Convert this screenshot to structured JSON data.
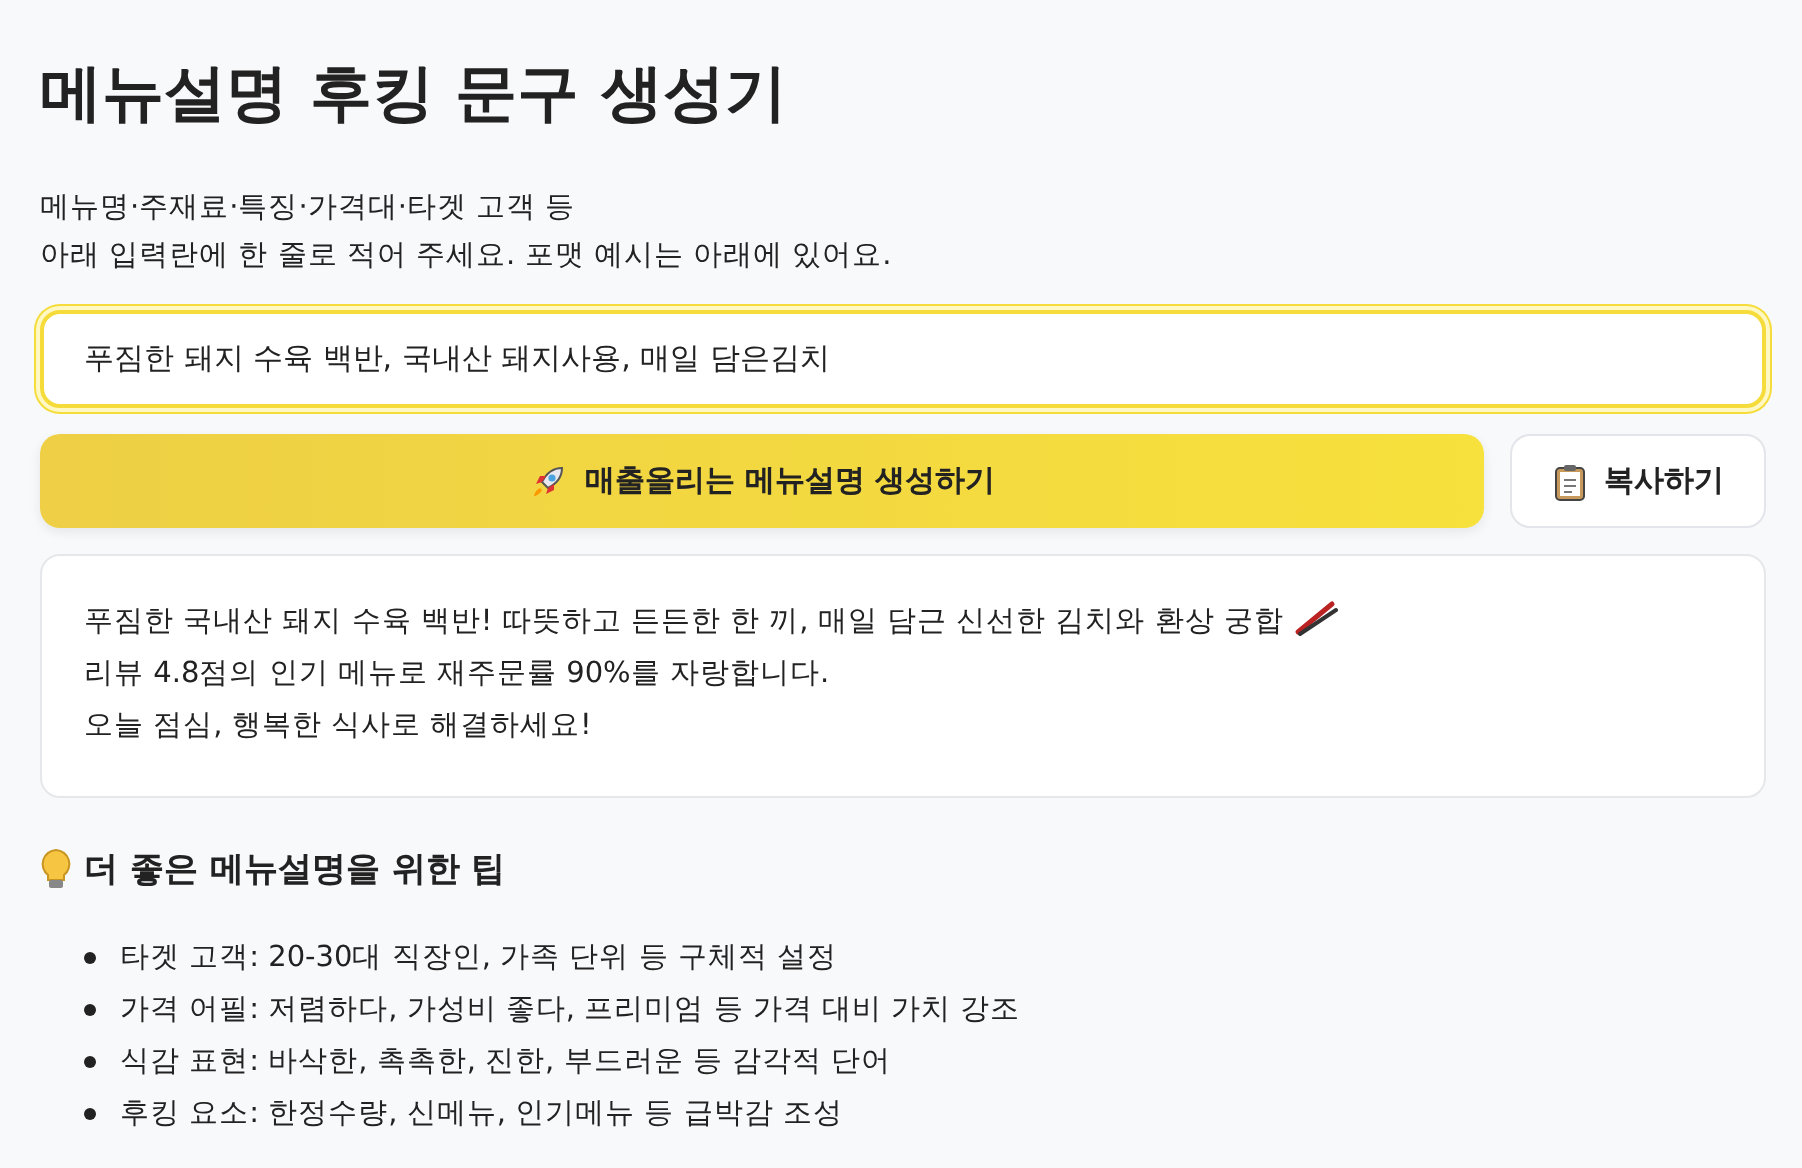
{
  "title": "메뉴설명 후킹 문구 생성기",
  "intro": [
    "메뉴명·주재료·특징·가격대·타겟 고객 등",
    "아래 입력란에 한 줄로 적어 주세요. 포맷 예시는 아래에 있어요."
  ],
  "input": {
    "value": "푸짐한 돼지 수육 백반, 국내산 돼지사용, 매일 담은김치",
    "focused": true
  },
  "buttons": [
    {
      "kind": "generate",
      "label": "매출올리는 메뉴설명 생성하기"
    },
    {
      "kind": "copy",
      "label": "복사하기"
    }
  ],
  "result": [
    "푸짐한 국내산 돼지 수육 백반! 따뜻하고 든든한 한 끼, 매일 담근 신선한 김치와 환상 궁합",
    "리뷰 4.8점의 인기 메뉴로 재주문률 90%를 자랑합니다.",
    "오늘 점심, 행복한 식사로 해결하세요!"
  ],
  "tips": {
    "heading": "더 좋은 메뉴설명을 위한 팁",
    "items": [
      "타겟 고객: 20-30대 직장인, 가족 단위 등 구체적 설정",
      "가격 어필: 저렴하다, 가성비 좋다, 프리미엄 등 가격 대비 가치 강조",
      "식감 표현: 바삭한, 촉촉한, 진한, 부드러운 등 감각적 단어",
      "후킹 요소: 한정수량, 신메뉴, 인기메뉴 등 급박감 조성"
    ]
  }
}
